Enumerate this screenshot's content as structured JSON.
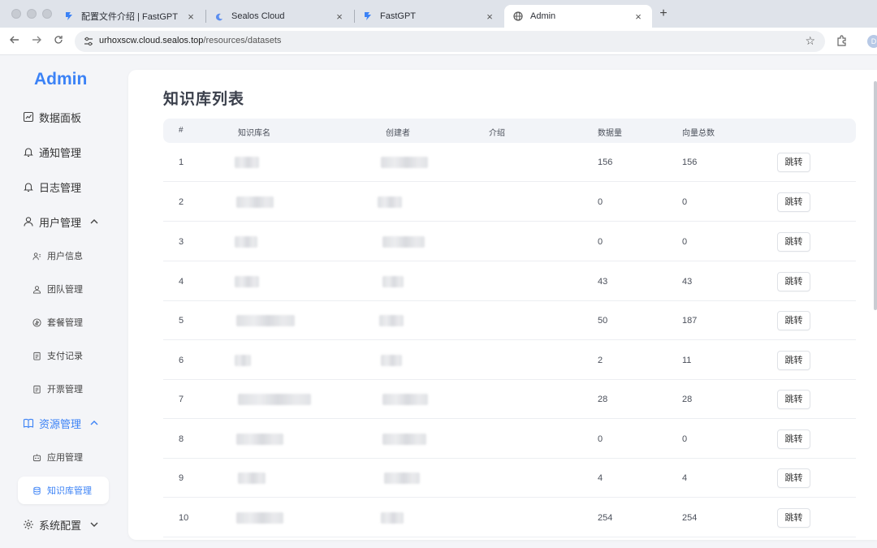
{
  "browser": {
    "tabs": [
      {
        "title": "配置文件介绍 | FastGPT",
        "favicon": "fastgpt-icon",
        "active": false
      },
      {
        "title": "Sealos Cloud",
        "favicon": "sealos-icon",
        "active": false
      },
      {
        "title": "FastGPT",
        "favicon": "fastgpt-icon",
        "active": false
      },
      {
        "title": "Admin",
        "favicon": "globe-icon",
        "active": true
      }
    ],
    "new_tab": "+",
    "close_glyph": "×",
    "url_host": "urhoxscw.cloud.sealos.top",
    "url_path": "/resources/datasets",
    "profile_initial": "D"
  },
  "sidebar": {
    "brand": "Admin",
    "items": [
      {
        "label": "数据面板",
        "icon": "chart-icon"
      },
      {
        "label": "通知管理",
        "icon": "bell-icon"
      },
      {
        "label": "日志管理",
        "icon": "bell-icon"
      },
      {
        "label": "用户管理",
        "icon": "user-icon",
        "expanded": true
      },
      {
        "label": "资源管理",
        "icon": "book-icon",
        "expanded": true
      },
      {
        "label": "系统配置",
        "icon": "gear-icon",
        "expanded": false
      }
    ],
    "user_sub": [
      {
        "label": "用户信息",
        "icon": "user-info-icon"
      },
      {
        "label": "团队管理",
        "icon": "team-icon"
      },
      {
        "label": "套餐管理",
        "icon": "coin-icon"
      },
      {
        "label": "支付记录",
        "icon": "receipt-icon"
      },
      {
        "label": "开票管理",
        "icon": "invoice-icon"
      }
    ],
    "resource_sub": [
      {
        "label": "应用管理",
        "icon": "robot-icon"
      },
      {
        "label": "知识库管理",
        "icon": "database-icon",
        "active": true
      }
    ]
  },
  "main": {
    "title": "知识库列表",
    "columns": [
      "#",
      "知识库名",
      "创建者",
      "介绍",
      "数据量",
      "向量总数",
      ""
    ],
    "jump_label": "跳转",
    "rows": [
      {
        "index": "1",
        "data_count": "156",
        "vector_total": "156"
      },
      {
        "index": "2",
        "data_count": "0",
        "vector_total": "0"
      },
      {
        "index": "3",
        "data_count": "0",
        "vector_total": "0"
      },
      {
        "index": "4",
        "data_count": "43",
        "vector_total": "43"
      },
      {
        "index": "5",
        "data_count": "50",
        "vector_total": "187"
      },
      {
        "index": "6",
        "data_count": "2",
        "vector_total": "11"
      },
      {
        "index": "7",
        "data_count": "28",
        "vector_total": "28"
      },
      {
        "index": "8",
        "data_count": "0",
        "vector_total": "0"
      },
      {
        "index": "9",
        "data_count": "4",
        "vector_total": "4"
      },
      {
        "index": "10",
        "data_count": "254",
        "vector_total": "254"
      }
    ]
  },
  "colors": {
    "accent": "#3b82f6",
    "sidebar_bg": "#f4f5f8",
    "table_header_bg": "#f2f4f8"
  }
}
